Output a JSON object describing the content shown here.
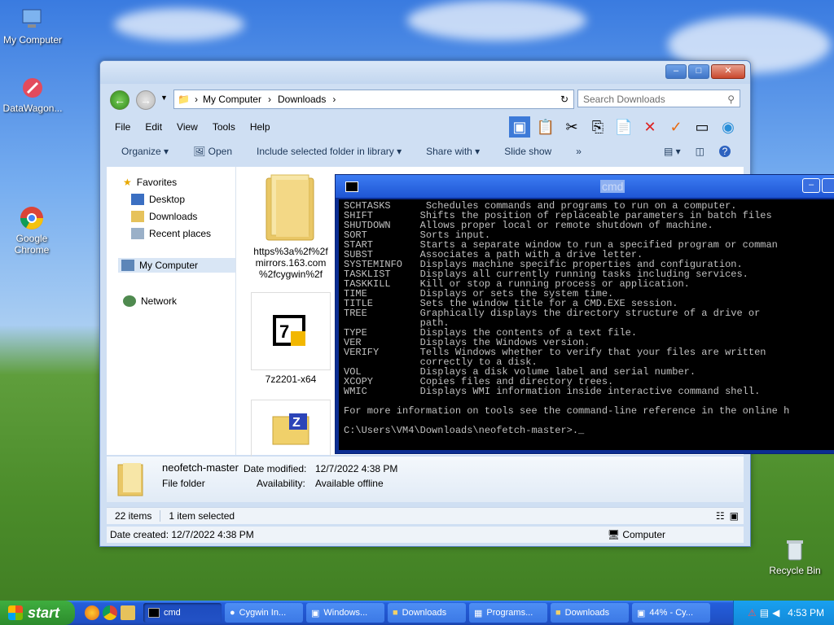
{
  "desktop": {
    "icons": [
      {
        "label": "My Computer"
      },
      {
        "label": "DataWagon..."
      },
      {
        "label": "Google Chrome"
      },
      {
        "label": "Recycle Bin"
      }
    ]
  },
  "explorer": {
    "breadcrumb": [
      "My Computer",
      "Downloads"
    ],
    "search_placeholder": "Search Downloads",
    "menu": [
      "File",
      "Edit",
      "View",
      "Tools",
      "Help"
    ],
    "commands": [
      "Organize",
      "Open",
      "Include selected folder in library",
      "Share with",
      "Slide show",
      "»"
    ],
    "nav": {
      "favorites": "Favorites",
      "desktop": "Desktop",
      "downloads": "Downloads",
      "recent": "Recent places",
      "computer": "My Computer",
      "network": "Network"
    },
    "files": [
      {
        "name": "https%3a%2f%2fmirrors.163.com%2fcygwin%2f",
        "line1": "https%3a%2f%2f",
        "line2": "mirrors.163.com",
        "line3": "%2fcygwin%2f"
      },
      {
        "name": "7z2201-x64"
      },
      {
        "name": ""
      }
    ],
    "details": {
      "name": "neofetch-master",
      "type": "File folder",
      "modified_label": "Date modified:",
      "modified_value": "12/7/2022 4:38 PM",
      "availability_label": "Availability:",
      "availability_value": "Available offline"
    },
    "status": {
      "items": "22 items",
      "selected": "1 item selected",
      "created": "Date created: 12/7/2022 4:38 PM",
      "location": "Computer"
    }
  },
  "cmd": {
    "title": "cmd",
    "lines": [
      "SCHTASKS      Schedules commands and programs to run on a computer.",
      "SHIFT        Shifts the position of replaceable parameters in batch files",
      "SHUTDOWN     Allows proper local or remote shutdown of machine.",
      "SORT         Sorts input.",
      "START        Starts a separate window to run a specified program or comman",
      "SUBST        Associates a path with a drive letter.",
      "SYSTEMINFO   Displays machine specific properties and configuration.",
      "TASKLIST     Displays all currently running tasks including services.",
      "TASKKILL     Kill or stop a running process or application.",
      "TIME         Displays or sets the system time.",
      "TITLE        Sets the window title for a CMD.EXE session.",
      "TREE         Graphically displays the directory structure of a drive or",
      "             path.",
      "TYPE         Displays the contents of a text file.",
      "VER          Displays the Windows version.",
      "VERIFY       Tells Windows whether to verify that your files are written",
      "             correctly to a disk.",
      "VOL          Displays a disk volume label and serial number.",
      "XCOPY        Copies files and directory trees.",
      "WMIC         Displays WMI information inside interactive command shell.",
      "",
      "For more information on tools see the command-line reference in the online h",
      "",
      "C:\\Users\\VM4\\Downloads\\neofetch-master>._"
    ]
  },
  "taskbar": {
    "start": "start",
    "tasks": [
      {
        "label": "cmd",
        "active": true
      },
      {
        "label": "Cygwin In..."
      },
      {
        "label": "Windows..."
      },
      {
        "label": "Downloads"
      },
      {
        "label": "Programs..."
      },
      {
        "label": "Downloads"
      },
      {
        "label": "44% - Cy..."
      }
    ],
    "clock": "4:53 PM"
  }
}
